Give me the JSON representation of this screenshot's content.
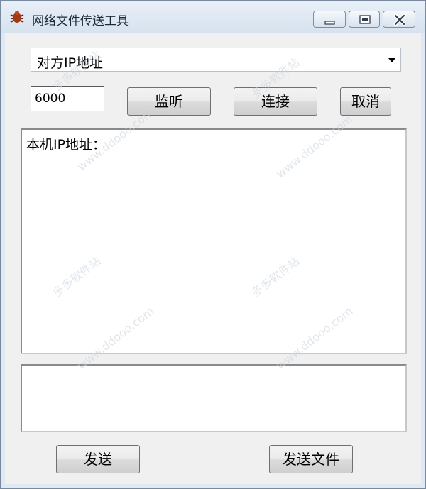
{
  "window": {
    "title": "网络文件传送工具",
    "icon": "bug-icon"
  },
  "ip_combo": {
    "value": "对方IP地址"
  },
  "port_field": {
    "value": "6000"
  },
  "buttons": {
    "listen": "监听",
    "connect": "连接",
    "cancel": "取消",
    "send": "发送",
    "send_file": "发送文件"
  },
  "log_area": {
    "text": "本机IP地址："
  },
  "message_area": {
    "text": ""
  },
  "watermarks": {
    "cn": "多多软件站",
    "url": "www.ddooo.com"
  }
}
